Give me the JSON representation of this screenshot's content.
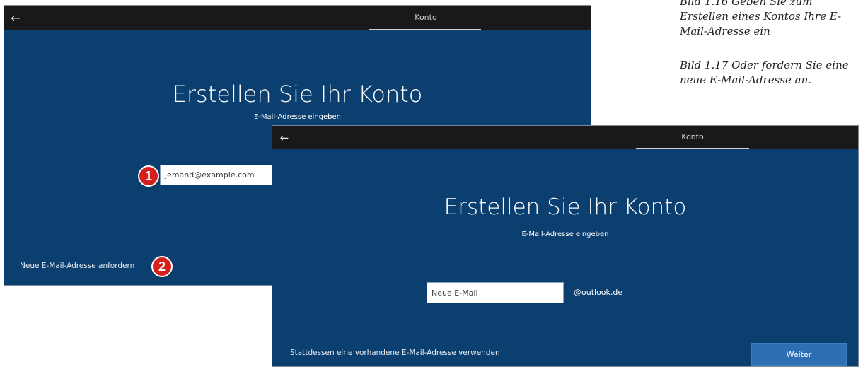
{
  "captions": {
    "figure_1_16": "Bild 1.16 Geben Sie zum Erstellen eines Kontos Ihre E-Mail-Adresse ein",
    "figure_1_17": "Bild 1.17 Oder fordern Sie eine neue E-Mail-Adresse an."
  },
  "window_back": {
    "back_icon": "←",
    "tab_title": "Konto",
    "heading": "Erstellen Sie Ihr Konto",
    "subheading": "E-Mail-Adresse eingeben",
    "email_placeholder": "jemand@example.com",
    "new_address_link": "Neue E-Mail-Adresse anfordern",
    "badge_1": "1",
    "badge_2": "2"
  },
  "window_front": {
    "back_icon": "←",
    "tab_title": "Konto",
    "heading": "Erstellen Sie Ihr Konto",
    "subheading": "E-Mail-Adresse eingeben",
    "email_placeholder": "Neue E-Mail",
    "domain_suffix": "@outlook.de",
    "existing_address_link": "Stattdessen eine vorhandene E-Mail-Adresse verwenden",
    "next_button": "Weiter"
  },
  "colors": {
    "window_background": "#0b3f6f",
    "titlebar": "#191919",
    "badge": "#d6201e",
    "primary_button": "#2e6fb3"
  }
}
